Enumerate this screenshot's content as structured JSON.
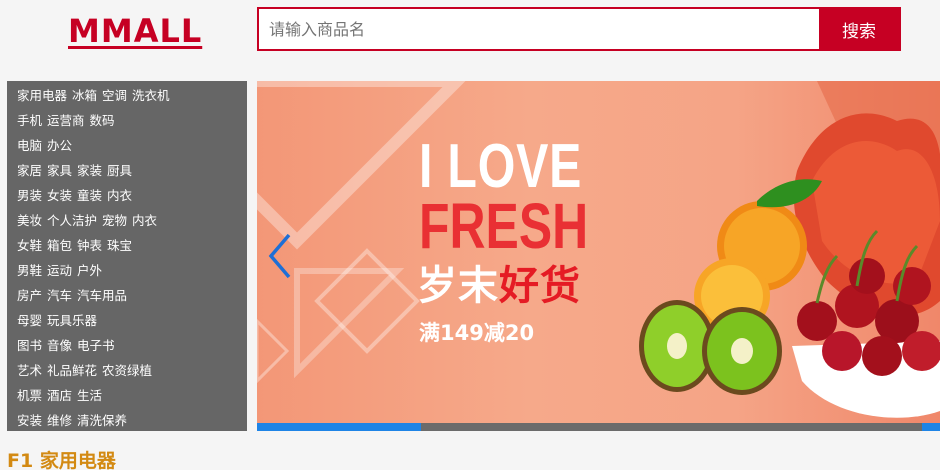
{
  "header": {
    "logo": "MMALL",
    "search": {
      "placeholder": "请输入商品名",
      "button_label": "搜索"
    }
  },
  "category_menu": [
    [
      "家用电器",
      "冰箱",
      "空调",
      "洗衣机"
    ],
    [
      "手机",
      "运营商",
      "数码"
    ],
    [
      "电脑",
      "办公"
    ],
    [
      "家居",
      "家具",
      "家装",
      "厨具"
    ],
    [
      "男装",
      "女装",
      "童装",
      "内衣"
    ],
    [
      "美妆",
      "个人洁护",
      "宠物",
      "内衣"
    ],
    [
      "女鞋",
      "箱包",
      "钟表",
      "珠宝"
    ],
    [
      "男鞋",
      "运动",
      "户外"
    ],
    [
      "房产",
      "汽车",
      "汽车用品"
    ],
    [
      "母婴",
      "玩具乐器"
    ],
    [
      "图书",
      "音像",
      "电子书"
    ],
    [
      "艺术",
      "礼品鲜花",
      "农资绿植"
    ],
    [
      "机票",
      "酒店",
      "生活"
    ],
    [
      "安装",
      "维修",
      "清洗保养"
    ]
  ],
  "banner": {
    "title_line1": "I LOVE",
    "title_line2": "FRESH",
    "slogan_part1": "岁末",
    "slogan_part2": "好货",
    "promo": "满149减20",
    "progress_fraction": 0.24,
    "colors": {
      "accent_red": "#e8242b",
      "indicator": "#1e84e6"
    },
    "prev_icon": "chevron-left-icon"
  },
  "floor": {
    "title": "F1 家用电器"
  },
  "colors": {
    "brand": "#c60023",
    "menu_bg": "#666666",
    "floor_title": "#d38a13"
  }
}
